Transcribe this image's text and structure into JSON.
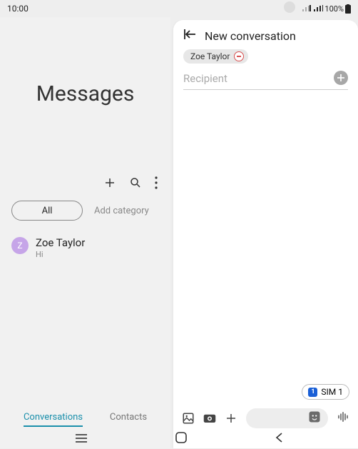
{
  "statusbar": {
    "time": "10:00",
    "battery": "100%"
  },
  "left": {
    "title": "Messages",
    "all_label": "All",
    "add_category": "Add category",
    "tabs": {
      "conversations": "Conversations",
      "contacts": "Contacts"
    },
    "convo": {
      "initial": "Z",
      "name": "Zoe Taylor",
      "preview": "Hi"
    }
  },
  "right": {
    "title": "New conversation",
    "chip_name": "Zoe Taylor",
    "recipient_placeholder": "Recipient",
    "sim_index": "1",
    "sim_label": "SIM 1"
  }
}
